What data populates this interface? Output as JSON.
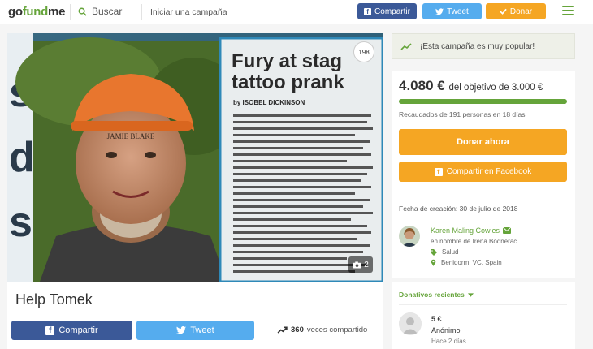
{
  "header": {
    "logo": {
      "part1": "go",
      "part2": "fund",
      "part3": "me"
    },
    "search_label": "Buscar",
    "start_campaign": "Iniciar una campaña",
    "share_facebook": "Compartir",
    "tweet": "Tweet",
    "donate": "Donar"
  },
  "photo": {
    "headline_line1": "Fury at stag",
    "headline_line2": "tattoo prank",
    "byline": "by ISOBEL DICKINSON",
    "counter": "198",
    "gallery_count": "2"
  },
  "campaign": {
    "title": "Help Tomek",
    "share_facebook": "Compartir",
    "tweet": "Tweet",
    "share_count": "360",
    "share_suffix": "veces compartido"
  },
  "sidebar": {
    "popular_text": "¡Esta campaña es muy popular!",
    "amount": "4.080 €",
    "goal_text": "del objetivo de 3.000 €",
    "progress_fraction": 1.0,
    "raised_text": "Recaudados de 191 personas en 18 días",
    "donate_now": "Donar ahora",
    "share_facebook": "Compartir en Facebook",
    "created": "Fecha de creación: 30 de julio de 2018",
    "organizer_name": "Karen Maling Cowles",
    "on_behalf": "en nombre de Irena Bodnerac",
    "category": "Salud",
    "location": "Benidorm, VC, Spain",
    "recent_header": "Donativos recientes",
    "donations": [
      {
        "amount": "5 €",
        "name": "Anónimo",
        "time": "Hace 2 días"
      }
    ]
  },
  "colors": {
    "brand_green": "#65a43a",
    "facebook": "#3b5998",
    "twitter": "#55acee",
    "donate_orange": "#f5a623"
  }
}
